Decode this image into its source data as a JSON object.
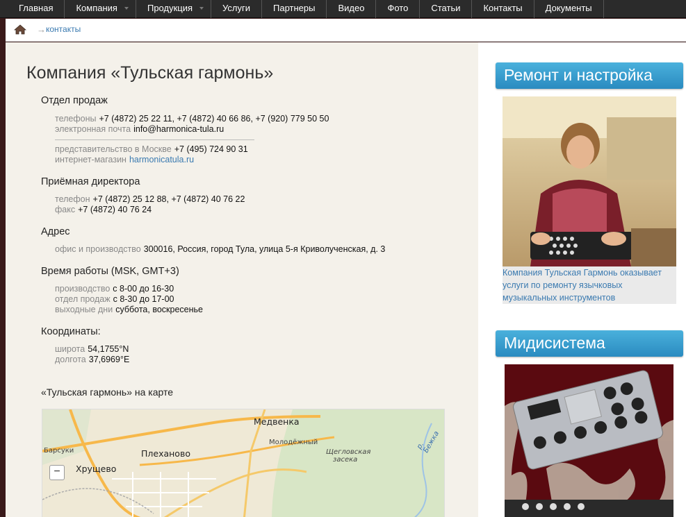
{
  "nav": {
    "items": [
      {
        "label": "Главная"
      },
      {
        "label": "Компания",
        "caret": true
      },
      {
        "label": "Продукция",
        "caret": true
      },
      {
        "label": "Услуги"
      },
      {
        "label": "Партнеры"
      },
      {
        "label": "Видео"
      },
      {
        "label": "Фото"
      },
      {
        "label": "Статьи"
      },
      {
        "label": "Контакты"
      },
      {
        "label": "Документы"
      }
    ]
  },
  "breadcrumb": {
    "arrow": "→",
    "current": "контакты",
    "home_icon": "home-icon"
  },
  "title": "Компания «Тульская гармонь»",
  "sales": {
    "heading": "Отдел продаж",
    "phones_label": "телефоны",
    "phones": "+7 (4872) 25 22 11, +7 (4872) 40 66 86, +7 (920) 779 50 50",
    "email_label": "электронная почта",
    "email": "info@harmonica-tula.ru",
    "moscow_label": "представительство в Москве",
    "moscow_phone": "+7 (495) 724 90 31",
    "shop_label": "интернет-магазин",
    "shop_link": "harmonicatula.ru"
  },
  "director": {
    "heading": "Приёмная директора",
    "phone_label": "телефон",
    "phone": "+7 (4872) 25 12 88, +7 (4872) 40 76 22",
    "fax_label": "факс",
    "fax": "+7 (4872) 40 76 24"
  },
  "address": {
    "heading": "Адрес",
    "label": "офис и производство",
    "value": "300016, Россия, город Тула, улица 5-я Криволученская, д. 3"
  },
  "hours": {
    "heading": "Время работы (MSK, GMT+3)",
    "production_label": "производство",
    "production": "с 8-00 до 16-30",
    "sales_label": "отдел продаж",
    "sales": "с 8-30 до 17-00",
    "weekend_label": "выходные дни",
    "weekend": "суббота, воскресенье"
  },
  "coords": {
    "heading": "Координаты:",
    "lat_label": "широта",
    "lat": "54,1755°N",
    "lon_label": "долгота",
    "lon": "37,6969°E"
  },
  "map": {
    "heading": "«Тульская гармонь» на карте",
    "labels": {
      "medvenka": "Медвенка",
      "molodezhny": "Молодёжный",
      "plekhanovo": "Плеханово",
      "khrushchevo": "Хрущево",
      "barsuki": "Барсуки",
      "zaseka_1": "Щегловская",
      "zaseka_2": "засека",
      "river": "р. Бежка"
    },
    "zoom_out": "−"
  },
  "side": {
    "repair_title": "Ремонт и настройка",
    "repair_caption": "Компания Тульская Гармонь оказывает услуги по ремонту язычковых музыкальных инструментов",
    "midi_title": "Мидисистема"
  },
  "colors": {
    "nav_bg": "#2b2b2b",
    "accent_blue": "#2a8bc0",
    "link": "#3a7ab0",
    "content_bg": "#f4f1ea"
  }
}
